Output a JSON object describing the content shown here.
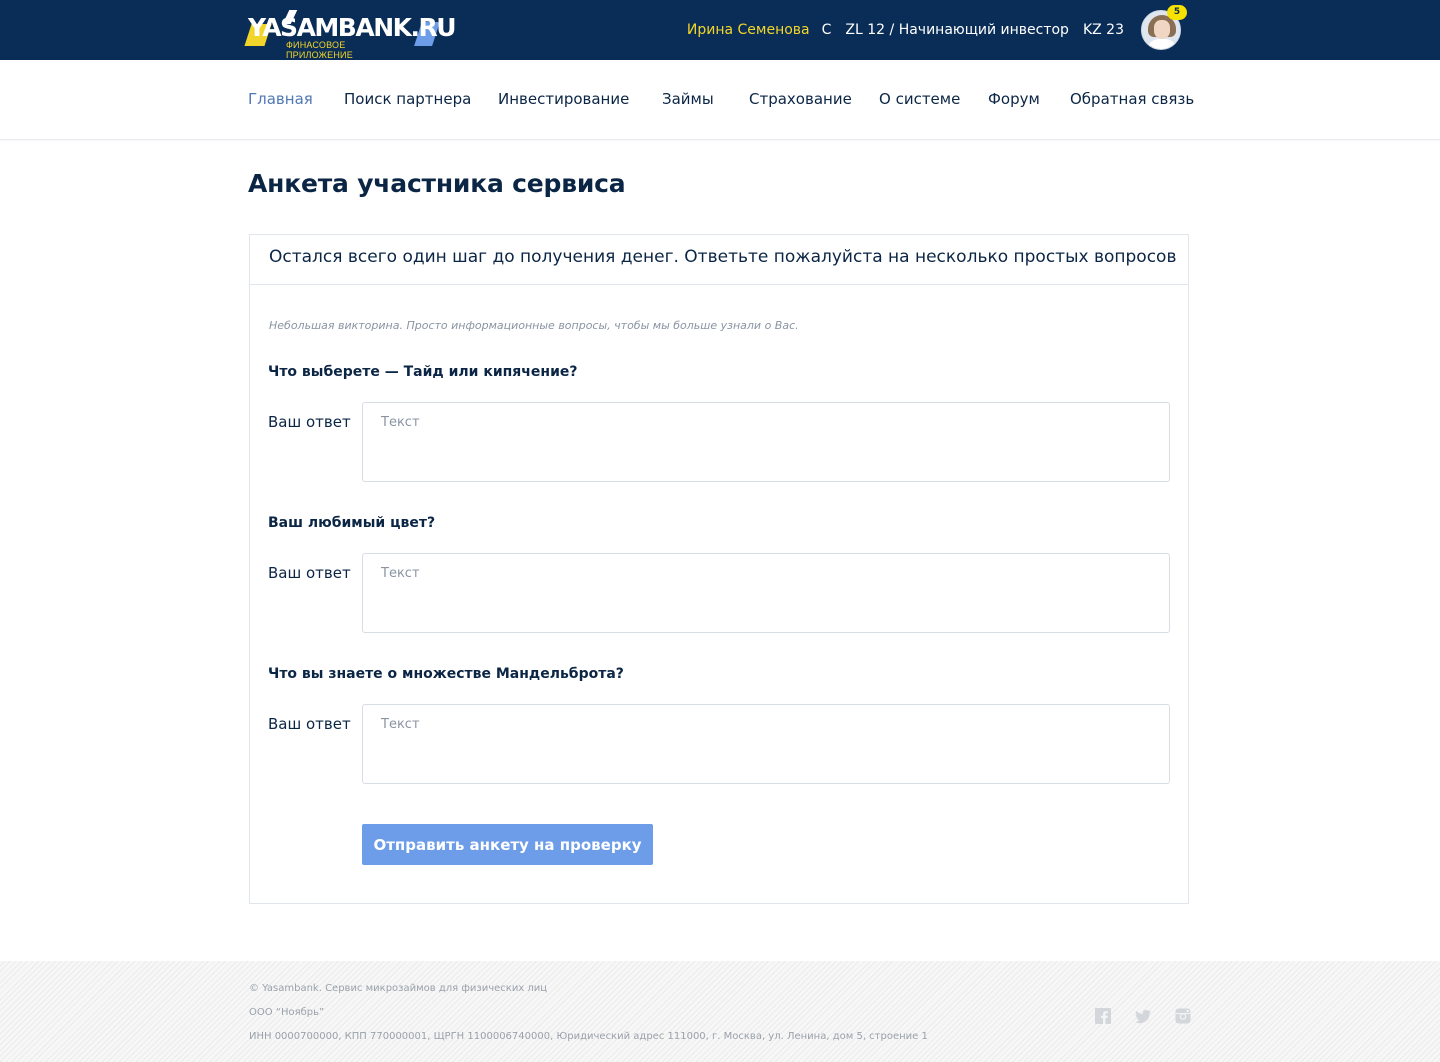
{
  "header": {
    "logo_text": "YASAMBANK.RU",
    "logo_subtitle": "ФИНАСОВОЕ ПРИЛОЖЕНИЕ",
    "user_name": "Ирина Семенова",
    "currency_c": "C",
    "level": "ZL 12 / Начинающий инвестор",
    "kz": "KZ 23",
    "notifications_count": "5",
    "avatar_icon": "user-avatar-photo"
  },
  "nav": {
    "items": [
      {
        "label": "Главная",
        "active": true
      },
      {
        "label": "Поиск партнера"
      },
      {
        "label": "Инвестирование"
      },
      {
        "label": "Займы"
      },
      {
        "label": "Страхование"
      },
      {
        "label": "О системе"
      },
      {
        "label": "Форум"
      },
      {
        "label": "Обратная связь"
      }
    ]
  },
  "page": {
    "title": "Анкета участника сервиса"
  },
  "form": {
    "header": "Остался всего один шаг до получения денег. Ответьте пожалуйста на несколько простых вопросов",
    "note": "Небольшая викторина. Просто информационные вопросы, чтобы мы больше узнали о Вас.",
    "questions": [
      {
        "question": "Что выберете — Тайд или кипячение?",
        "answer_label": "Ваш ответ",
        "placeholder": "Текст",
        "value": ""
      },
      {
        "question": "Ваш любимый цвет?",
        "answer_label": "Ваш ответ",
        "placeholder": "Текст",
        "value": ""
      },
      {
        "question": "Что вы знаете о множестве Мандельброта?",
        "answer_label": "Ваш ответ",
        "placeholder": "Текст",
        "value": ""
      }
    ],
    "submit_label": "Отправить анкету на проверку"
  },
  "footer": {
    "line1": "© Yasambank. Сервис микрозаймов для физических лиц",
    "line2": "ООО “Ноябрь”",
    "line3": "ИНН 0000700000, КПП 770000001, ЩРГН 1100006740000, Юридический адрес 111000, г. Москва, ул. Ленина, дом 5, строение 1",
    "social_icons": [
      "facebook-icon",
      "twitter-icon",
      "instagram-icon"
    ]
  },
  "colors": {
    "topbar": "#0a2d57",
    "accent_yellow": "#f2d52a",
    "active_nav": "#4f78b5",
    "button": "#6d9de8",
    "text_dark": "#0b2545"
  }
}
